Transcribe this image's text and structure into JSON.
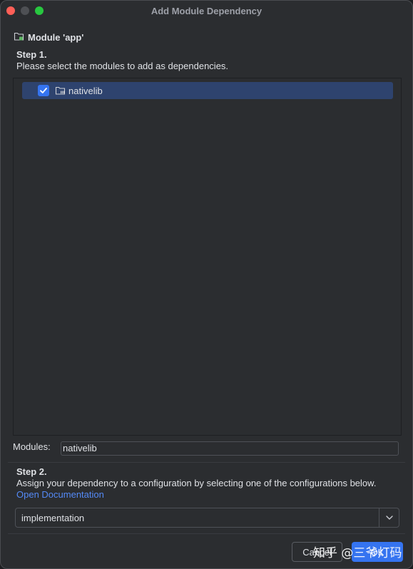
{
  "window": {
    "title": "Add Module Dependency"
  },
  "module": {
    "label": "Module 'app'"
  },
  "step1": {
    "title": "Step 1.",
    "description": "Please select the modules to add as dependencies."
  },
  "tree": {
    "items": [
      {
        "label": "nativelib",
        "checked": true
      }
    ]
  },
  "modules_field": {
    "label": "Modules:",
    "value": "nativelib"
  },
  "step2": {
    "title": "Step 2.",
    "description": "Assign your dependency to a configuration by selecting one of the configurations below.",
    "link": "Open Documentation"
  },
  "configuration": {
    "selected": "implementation"
  },
  "buttons": {
    "cancel": "Cancel",
    "ok": "OK"
  },
  "watermark": "知乎 @三爷灯码",
  "colors": {
    "accent": "#3574f0",
    "selection": "#2e436e",
    "link": "#548af7"
  }
}
